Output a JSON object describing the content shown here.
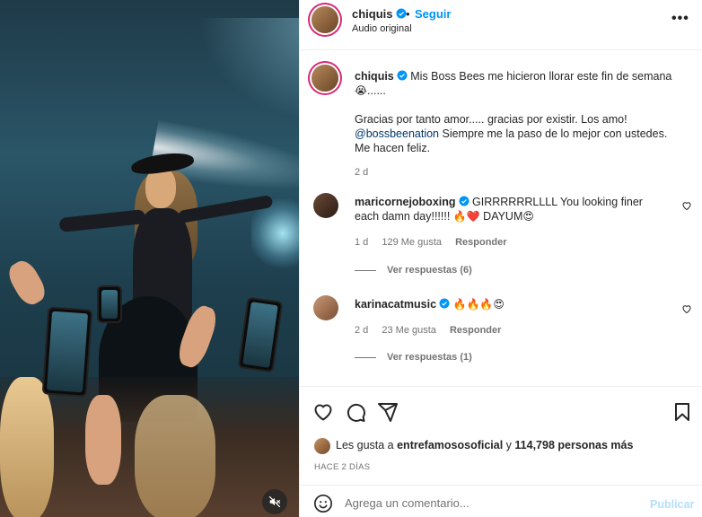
{
  "header": {
    "username": "chiquis",
    "dot": "•",
    "follow_label": "Seguir",
    "audio_label": "Audio original",
    "more_icon": "more-horizontal-icon"
  },
  "caption": {
    "username": "chiquis",
    "line1": "Mis Boss Bees me hicieron llorar este fin de semana",
    "line1_emoji": "😭",
    "line1_tail": "......",
    "line2": "Gracias por tanto amor..... gracias por existir. Los amo!",
    "mention": "@bossbeenation",
    "line3": " Siempre me la paso de lo mejor con ustedes. Me hacen feliz.",
    "time": "2 d"
  },
  "comments": [
    {
      "username": "maricornejoboxing",
      "text": "GIRRRRRRLLLL You looking finer each damn day!!!!!! ",
      "emojis": "🔥❤️",
      "text_tail": " DAYUM",
      "emojis_tail": "😍",
      "time": "1 d",
      "likes": "129 Me gusta",
      "reply_label": "Responder",
      "view_replies": "Ver respuestas (6)"
    },
    {
      "username": "karinacatmusic",
      "text": "",
      "emojis": "🔥🔥🔥😍",
      "text_tail": "",
      "emojis_tail": "",
      "time": "2 d",
      "likes": "23 Me gusta",
      "reply_label": "Responder",
      "view_replies": "Ver respuestas (1)"
    }
  ],
  "likes": {
    "prefix": "Les gusta a ",
    "user": "entrefamososoficial",
    "middle": " y ",
    "count": "114,798 personas más"
  },
  "time_ago": "HACE 2 DÍAS",
  "add_comment": {
    "placeholder": "Agrega un comentario...",
    "post_label": "Publicar"
  },
  "colors": {
    "accent": "#0095f6",
    "mention": "#00376b",
    "muted": "#737373",
    "post_disabled": "#b2dffc",
    "heart_red": "#ed4956"
  },
  "icons": [
    "heart-icon",
    "comment-icon",
    "share-icon",
    "bookmark-icon",
    "emoji-icon",
    "muted-speaker-icon",
    "verified-badge-icon"
  ]
}
